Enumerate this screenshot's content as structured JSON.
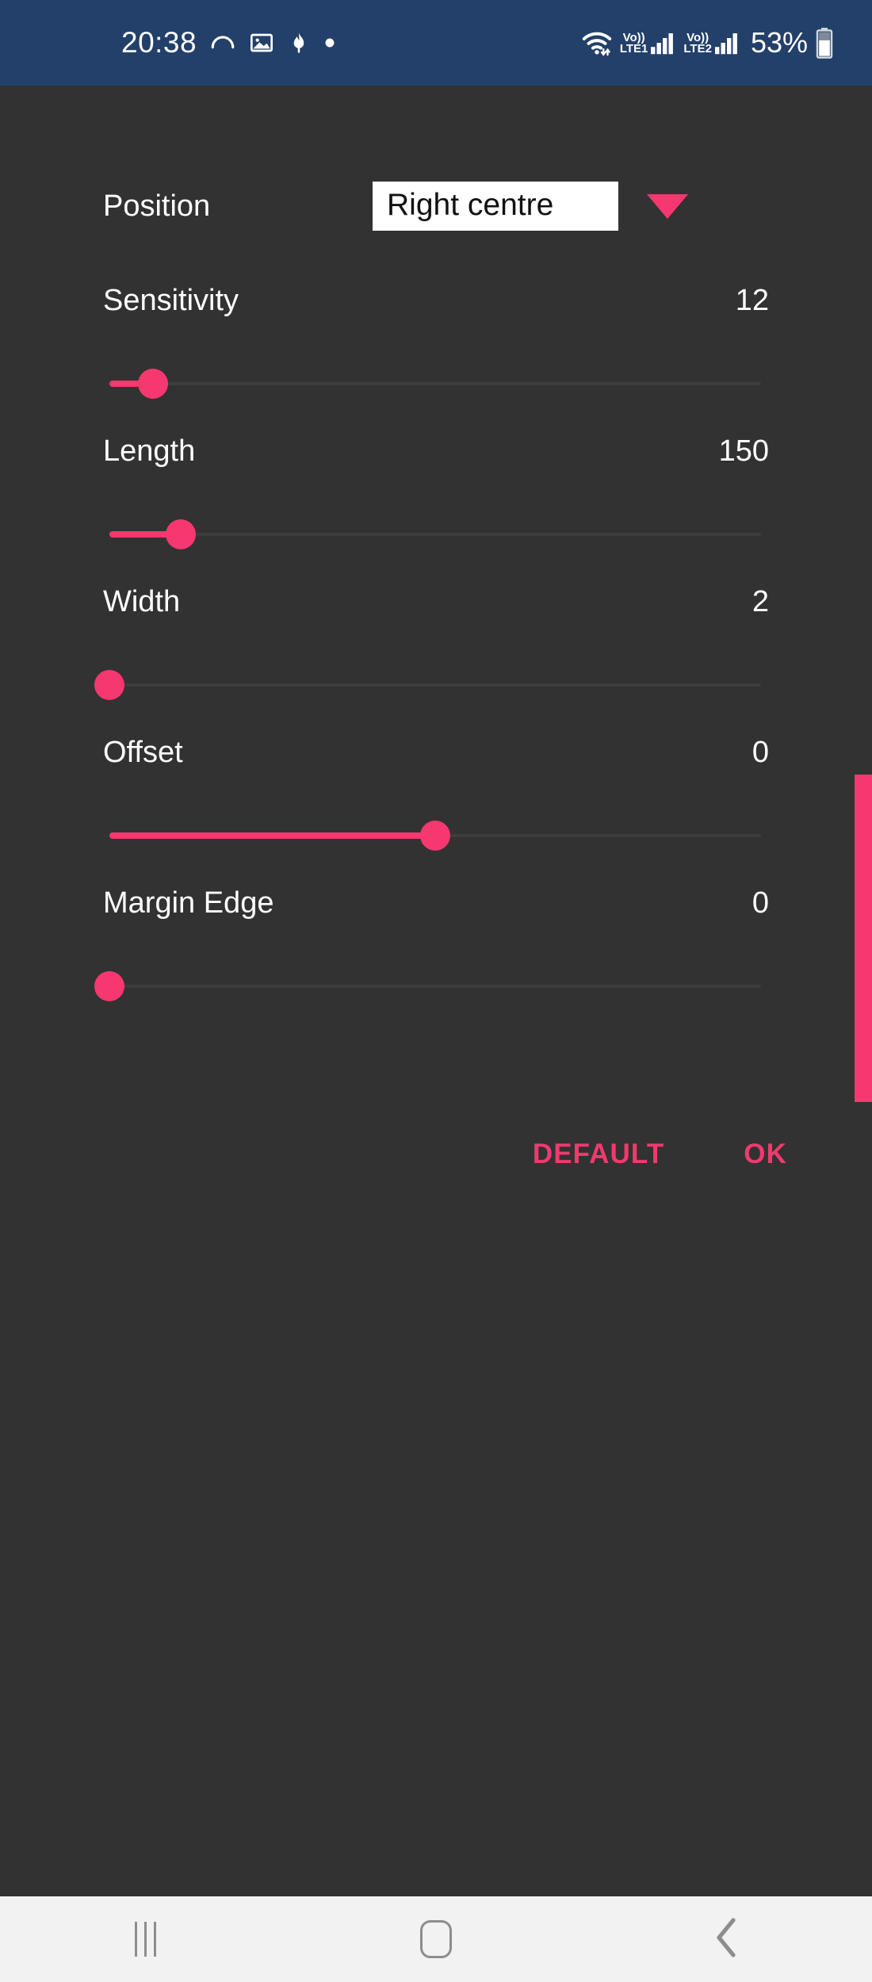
{
  "status_bar": {
    "time": "20:38",
    "left_icons": [
      "cloud-arc-icon",
      "image-icon",
      "do-not-disturb-icon",
      "dot-icon"
    ],
    "wifi_icon": "wifi-icon",
    "sim1": {
      "volte_top": "Vo))",
      "volte_bottom": "LTE1",
      "signal": "signal-bars-icon"
    },
    "sim2": {
      "volte_top": "Vo))",
      "volte_bottom": "LTE2",
      "signal": "signal-bars-icon"
    },
    "battery_percent": "53%",
    "battery_icon": "battery-icon",
    "background_color": "#23406a"
  },
  "dialog": {
    "position": {
      "label": "Position",
      "value": "Right centre",
      "dropdown_icon": "chevron-down-icon"
    },
    "sliders": [
      {
        "name": "Sensitivity",
        "value": "12",
        "fill_percent": 6.7,
        "thumb_percent": 6.7
      },
      {
        "name": "Length",
        "value": "150",
        "fill_percent": 11.0,
        "thumb_percent": 11.0
      },
      {
        "name": "Width",
        "value": "2",
        "fill_percent": 0.0,
        "thumb_percent": 0.0
      },
      {
        "name": "Offset",
        "value": "0",
        "fill_percent": 50.0,
        "thumb_percent": 50.0
      },
      {
        "name": "Margin Edge",
        "value": "0",
        "fill_percent": 0.0,
        "thumb_percent": 0.0
      }
    ],
    "buttons": {
      "default_label": "DEFAULT",
      "ok_label": "OK"
    },
    "accent_color": "#f7376f",
    "background_color": "#323232"
  },
  "edge_preview": {
    "name": "edge-bar-preview",
    "color": "#f7376f"
  },
  "nav_bar": {
    "recents_label": "recents-icon",
    "home_label": "home-icon",
    "back_label": "back-icon",
    "background_color": "#f2f2f2"
  }
}
